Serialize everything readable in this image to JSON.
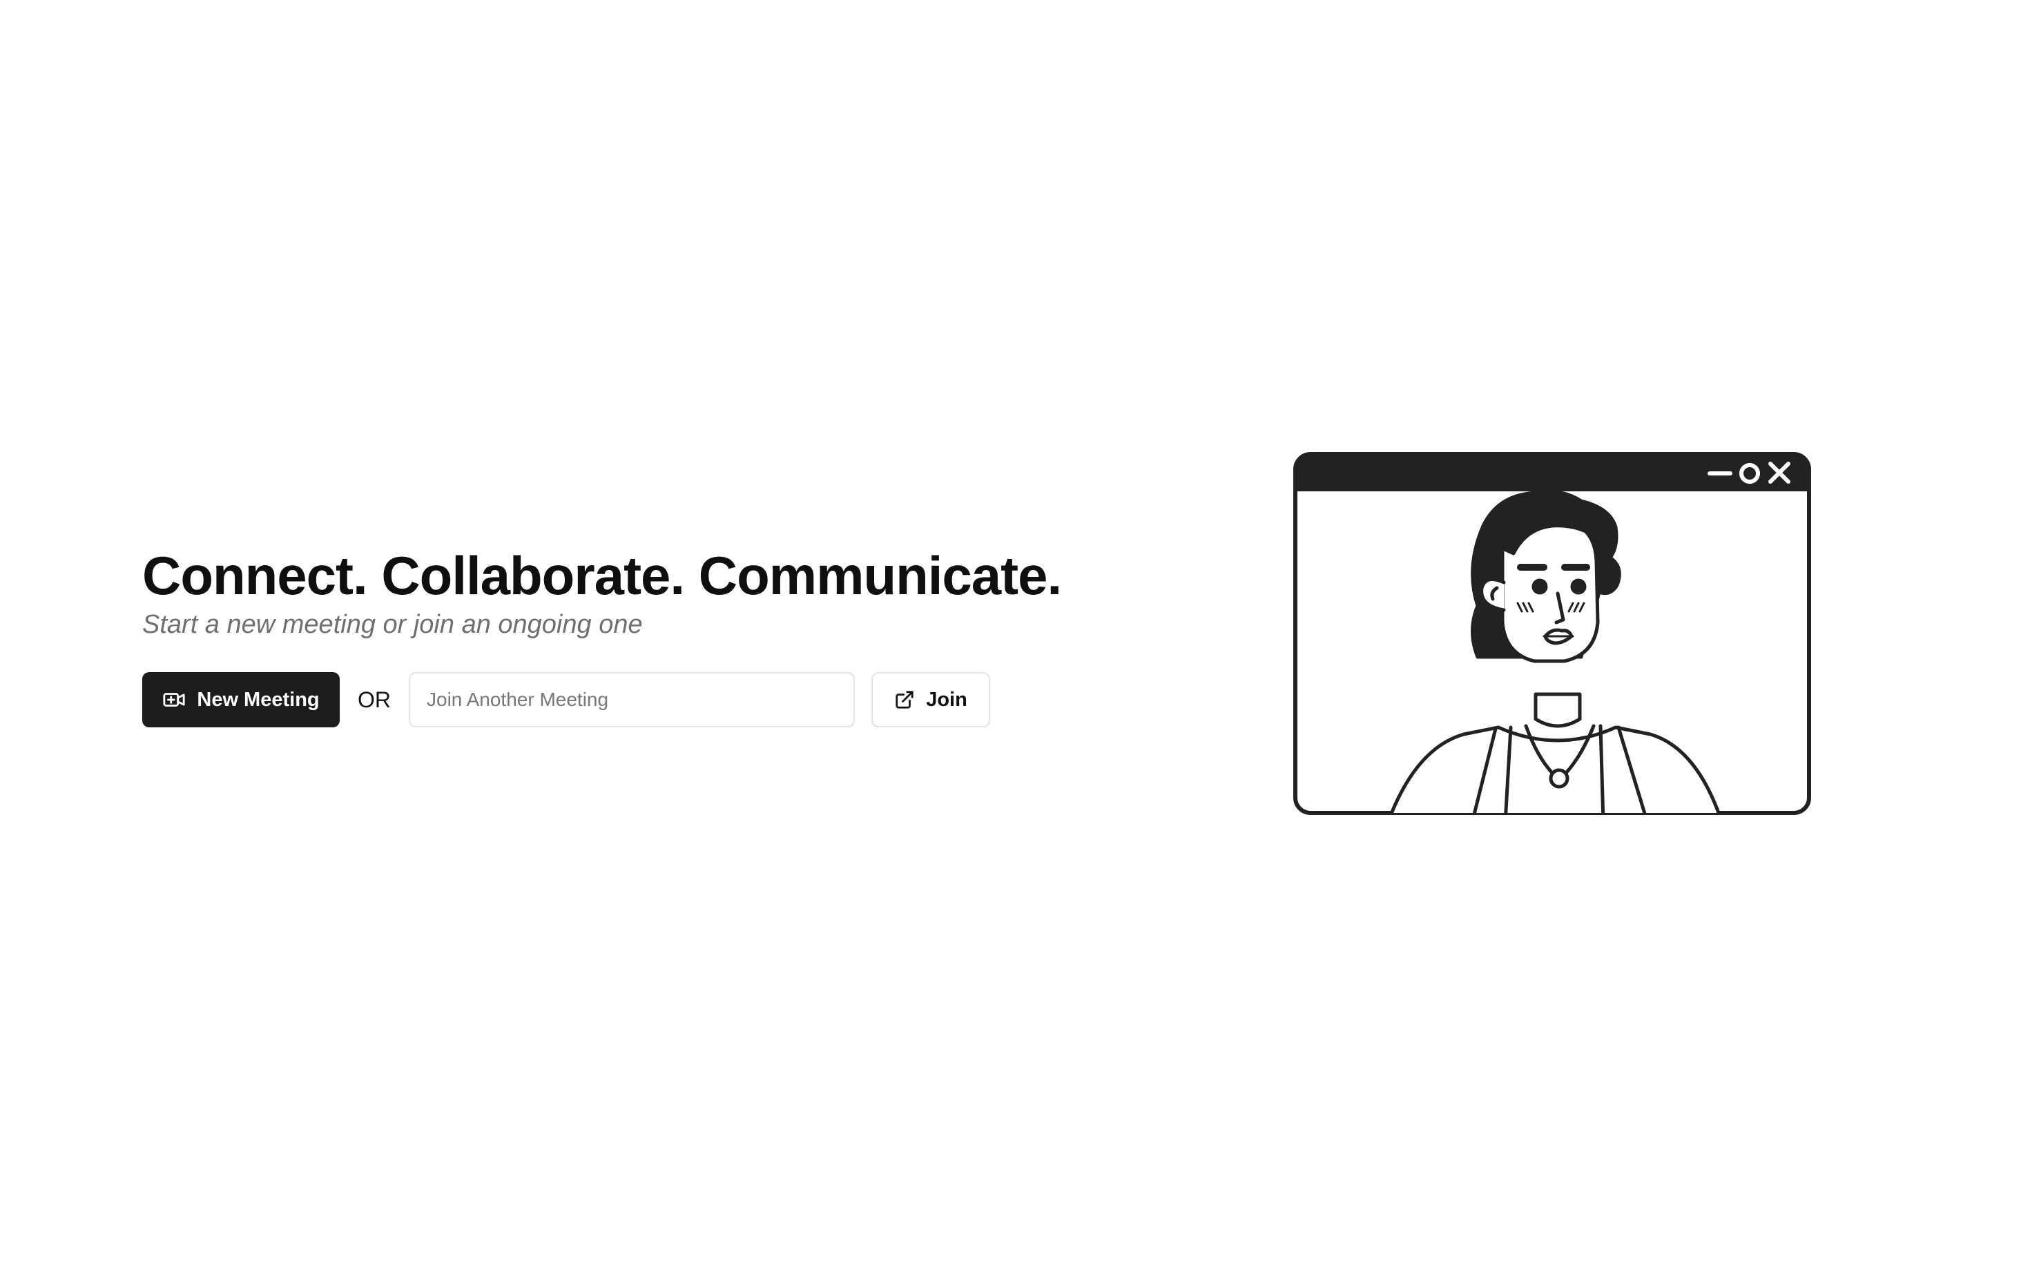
{
  "hero": {
    "headline": "Connect. Collaborate. Communicate.",
    "subheadline": "Start a new meeting or join an ongoing one"
  },
  "actions": {
    "new_meeting_label": "New Meeting",
    "new_meeting_icon": "video-plus-icon",
    "or_label": "OR",
    "join_input_value": "",
    "join_input_placeholder": "Join Another Meeting",
    "join_label": "Join",
    "join_icon": "external-link-icon"
  },
  "illustration": {
    "window_controls": [
      "minimize-icon",
      "maximize-icon",
      "close-icon"
    ],
    "subject": "person-avatar-illustration"
  },
  "colors": {
    "background": "#ffffff",
    "primary_button": "#1c1c1c",
    "primary_text": "#ffffff",
    "headline": "#0f0f0f",
    "subheadline": "#6f6f6f",
    "border": "#e3e3e3",
    "illustration_ink": "#222222"
  }
}
